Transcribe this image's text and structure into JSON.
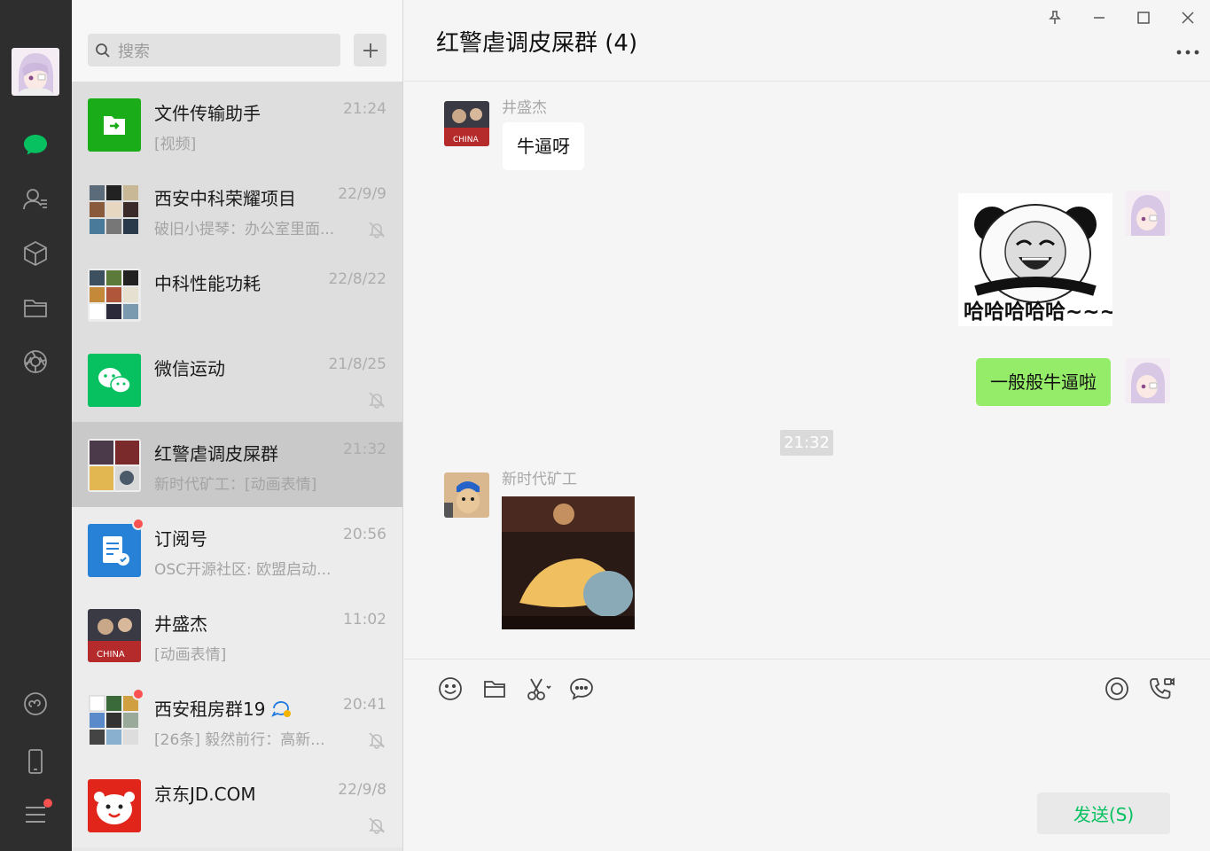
{
  "search": {
    "placeholder": "搜索"
  },
  "chats": [
    {
      "title": "文件传输助手",
      "time": "21:24",
      "preview": "[视频]",
      "muted": false
    },
    {
      "title": "西安中科荣耀项目",
      "time": "22/9/9",
      "preview": "破旧小提琴：办公室里面...",
      "muted": true
    },
    {
      "title": "中科性能功耗",
      "time": "22/8/22",
      "preview": "",
      "muted": false
    },
    {
      "title": "微信运动",
      "time": "21/8/25",
      "preview": "",
      "muted": true
    },
    {
      "title": "红警虐调皮屎群",
      "time": "21:32",
      "preview": "新时代矿工：[动画表情]",
      "muted": false
    },
    {
      "title": "订阅号",
      "time": "20:56",
      "preview": "OSC开源社区: 欧盟启动...",
      "muted": false
    },
    {
      "title": "井盛杰",
      "time": "11:02",
      "preview": "[动画表情]",
      "muted": false
    },
    {
      "title": "西安租房群19",
      "time": "20:41",
      "preview": "[26条] 毅然前行：高新...",
      "muted": true
    },
    {
      "title": "京东JD.COM",
      "time": "22/9/8",
      "preview": "",
      "muted": true
    }
  ],
  "conversation": {
    "title": "红警虐调皮屎群 (4)",
    "messages": {
      "m1_sender": "井盛杰",
      "m1_text": "牛逼呀",
      "m2_sticker_caption": "哈哈哈哈哈~~~",
      "m3_text": "一般般牛逼啦",
      "time_separator": "21:32",
      "m4_sender": "新时代矿工"
    },
    "send_label": "发送(S)"
  },
  "colors": {
    "accent": "#07c160",
    "bubble_out": "#95ec69",
    "unread": "#fa5151"
  }
}
